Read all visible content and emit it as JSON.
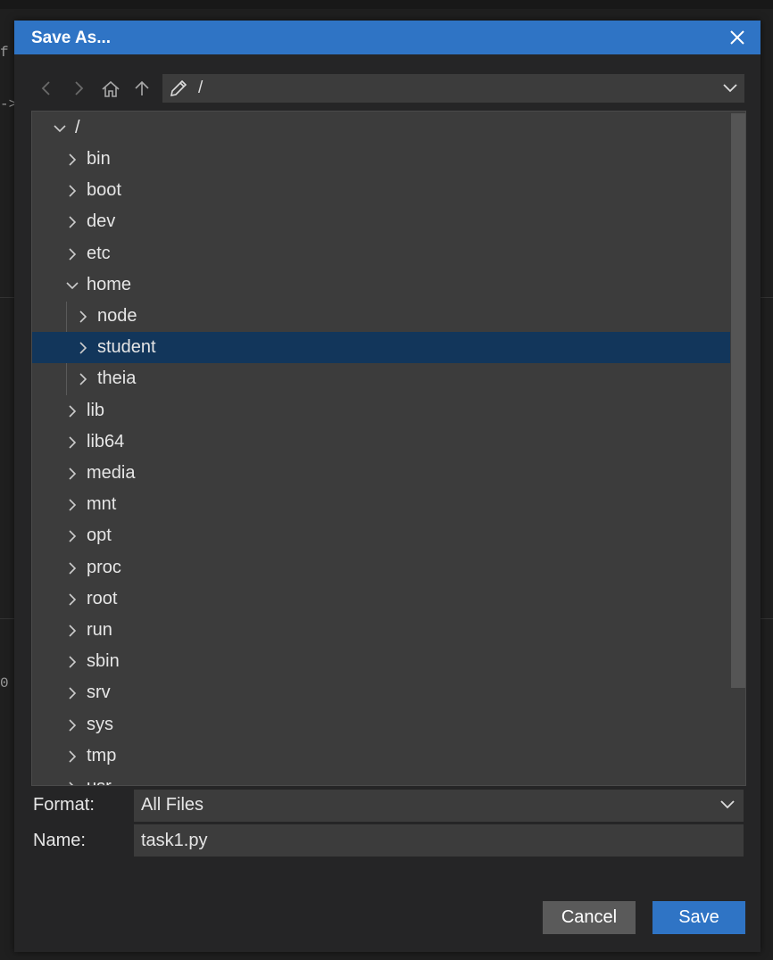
{
  "background": {
    "frag_top": "f",
    "frag_arrow": "->",
    "frag_num": "0"
  },
  "dialog": {
    "title": "Save As...",
    "path": "/",
    "tree": {
      "root": "/",
      "items": [
        {
          "label": "bin",
          "expanded": false,
          "selected": false
        },
        {
          "label": "boot",
          "expanded": false,
          "selected": false
        },
        {
          "label": "dev",
          "expanded": false,
          "selected": false
        },
        {
          "label": "etc",
          "expanded": false,
          "selected": false
        },
        {
          "label": "home",
          "expanded": true,
          "selected": false
        },
        {
          "label": "node",
          "expanded": false,
          "selected": false
        },
        {
          "label": "student",
          "expanded": false,
          "selected": true
        },
        {
          "label": "theia",
          "expanded": false,
          "selected": false
        },
        {
          "label": "lib",
          "expanded": false,
          "selected": false
        },
        {
          "label": "lib64",
          "expanded": false,
          "selected": false
        },
        {
          "label": "media",
          "expanded": false,
          "selected": false
        },
        {
          "label": "mnt",
          "expanded": false,
          "selected": false
        },
        {
          "label": "opt",
          "expanded": false,
          "selected": false
        },
        {
          "label": "proc",
          "expanded": false,
          "selected": false
        },
        {
          "label": "root",
          "expanded": false,
          "selected": false
        },
        {
          "label": "run",
          "expanded": false,
          "selected": false
        },
        {
          "label": "sbin",
          "expanded": false,
          "selected": false
        },
        {
          "label": "srv",
          "expanded": false,
          "selected": false
        },
        {
          "label": "sys",
          "expanded": false,
          "selected": false
        },
        {
          "label": "tmp",
          "expanded": false,
          "selected": false
        },
        {
          "label": "usr",
          "expanded": false,
          "selected": false
        }
      ]
    },
    "format_label": "Format:",
    "format_value": "All Files",
    "name_label": "Name:",
    "name_value": "task1.py",
    "cancel_label": "Cancel",
    "save_label": "Save",
    "colors": {
      "accent": "#2f74c5",
      "selection": "#12365b",
      "panel": "#3c3c3c"
    }
  }
}
